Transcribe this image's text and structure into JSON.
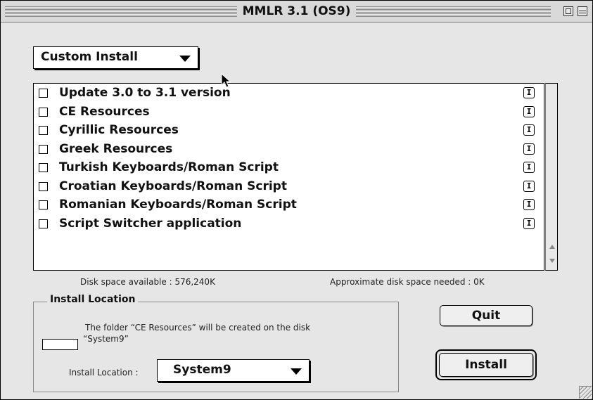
{
  "window": {
    "title": "MMLR 3.1 (OS9)"
  },
  "install_mode": {
    "selected": "Custom Install"
  },
  "components": [
    {
      "label": "Update 3.0 to 3.1 version",
      "checked": false
    },
    {
      "label": "CE Resources",
      "checked": false
    },
    {
      "label": "Cyrillic Resources",
      "checked": false
    },
    {
      "label": "Greek Resources",
      "checked": false
    },
    {
      "label": "Turkish Keyboards/Roman Script",
      "checked": false
    },
    {
      "label": "Croatian Keyboards/Roman Script",
      "checked": false
    },
    {
      "label": "Romanian Keyboards/Roman Script",
      "checked": false
    },
    {
      "label": "Script Switcher application",
      "checked": false
    }
  ],
  "info_glyph": "I",
  "disk": {
    "available": "Disk space available : 576,240K",
    "needed": "Approximate disk space needed : 0K"
  },
  "install_location": {
    "group_title": "Install Location",
    "message_line1": "The folder “CE Resources” will be created on the disk",
    "message_line2": "“System9”",
    "label": "Install Location :",
    "selected": "System9"
  },
  "buttons": {
    "quit": "Quit",
    "install": "Install"
  },
  "icons": {
    "zoom": "zoom-box-icon",
    "collapse": "collapse-box-icon",
    "info": "info-icon",
    "dropdown": "triangle-down-icon",
    "scroll_up": "scroll-up-arrow-icon",
    "scroll_down": "scroll-down-arrow-icon",
    "grow": "resize-grip-icon",
    "cursor": "pointer-cursor-icon"
  }
}
